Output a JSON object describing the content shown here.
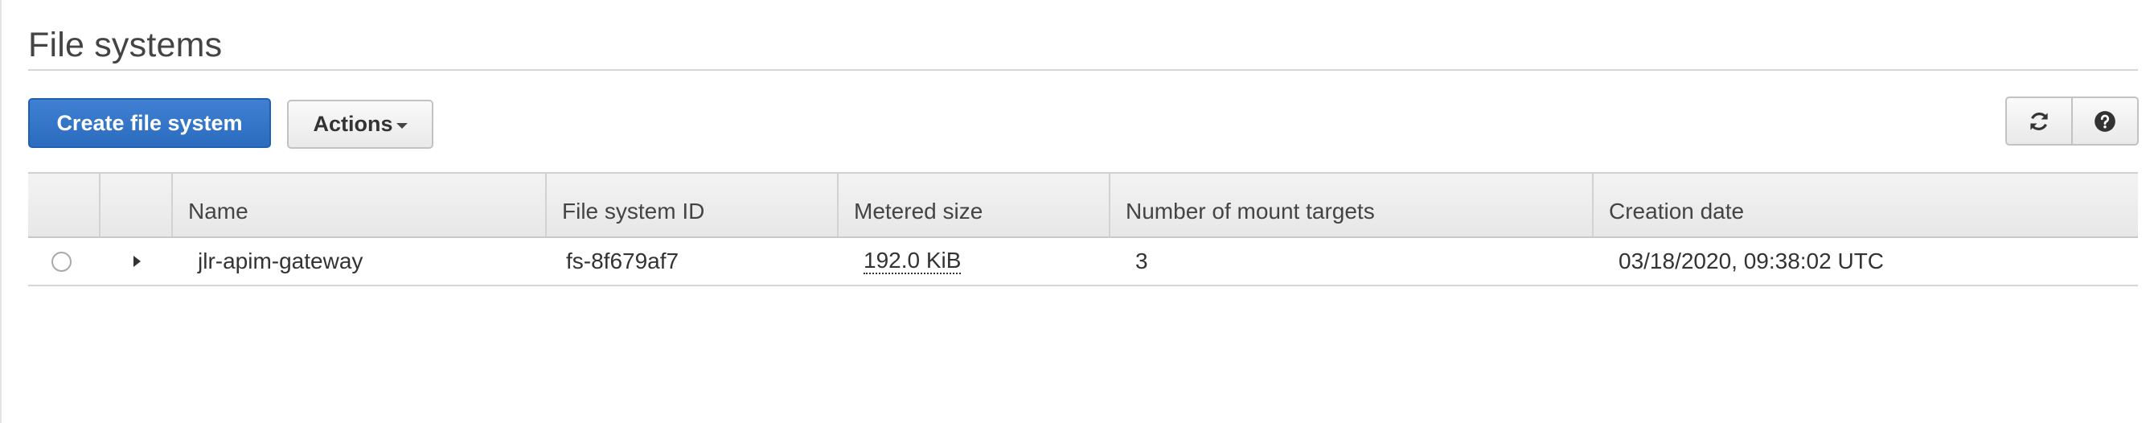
{
  "page": {
    "title": "File systems"
  },
  "toolbar": {
    "create_label": "Create file system",
    "actions_label": "Actions",
    "refresh_icon": "refresh-icon",
    "help_icon": "help-icon"
  },
  "table": {
    "columns": [
      "",
      "",
      "Name",
      "File system ID",
      "Metered size",
      "Number of mount targets",
      "Creation date"
    ],
    "rows": [
      {
        "selected": false,
        "expanded": false,
        "name": "jlr-apim-gateway",
        "id": "fs-8f679af7",
        "metered_size": "192.0 KiB",
        "mount_targets": "3",
        "creation_date": "03/18/2020, 09:38:02 UTC"
      }
    ]
  },
  "colors": {
    "primary": "#2b6cbf",
    "border": "#c2c2c2",
    "header_bg": "#ececec"
  }
}
